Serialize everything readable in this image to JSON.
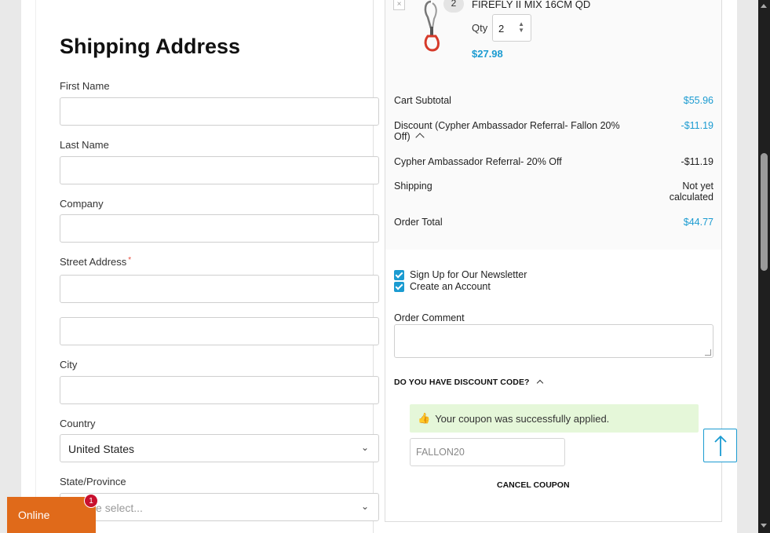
{
  "shipping": {
    "title": "Shipping Address",
    "first_name_label": "First Name",
    "last_name_label": "Last Name",
    "company_label": "Company",
    "street_label": "Street Address",
    "required_mark": "*",
    "city_label": "City",
    "country_label": "Country",
    "country_value": "United States",
    "state_label": "State/Province",
    "state_placeholder": "Please select..."
  },
  "cart": {
    "item": {
      "name": "FIREFLY II MIX 16CM QD",
      "badge_qty": "2",
      "qty_label": "Qty",
      "qty_value": "2",
      "price": "$27.98",
      "remove": "×"
    },
    "summary": {
      "subtotal_label": "Cart Subtotal",
      "subtotal_value": "$55.96",
      "discount_label": "Discount (Cypher Ambassador Referral- Fallon 20% Off)",
      "discount_value": "-$11.19",
      "referral_label": "Cypher Ambassador Referral- 20% Off",
      "referral_value": "-$11.19",
      "shipping_label": "Shipping",
      "shipping_value": "Not yet calculated",
      "total_label": "Order Total",
      "total_value": "$44.77"
    },
    "newsletter_label": "Sign Up for Our Newsletter",
    "create_account_label": "Create an Account",
    "comment_label": "Order Comment",
    "discount_heading": "DO YOU HAVE DISCOUNT CODE?",
    "coupon_success": "Your coupon was successfully applied.",
    "coupon_code": "FALLON20",
    "cancel_coupon": "CANCEL COUPON"
  },
  "chat": {
    "label": "Online",
    "badge": "1"
  },
  "colors": {
    "accent": "#1b9bd1",
    "chat_tab": "#e06a1a",
    "success_bg": "#e5f7d9"
  }
}
